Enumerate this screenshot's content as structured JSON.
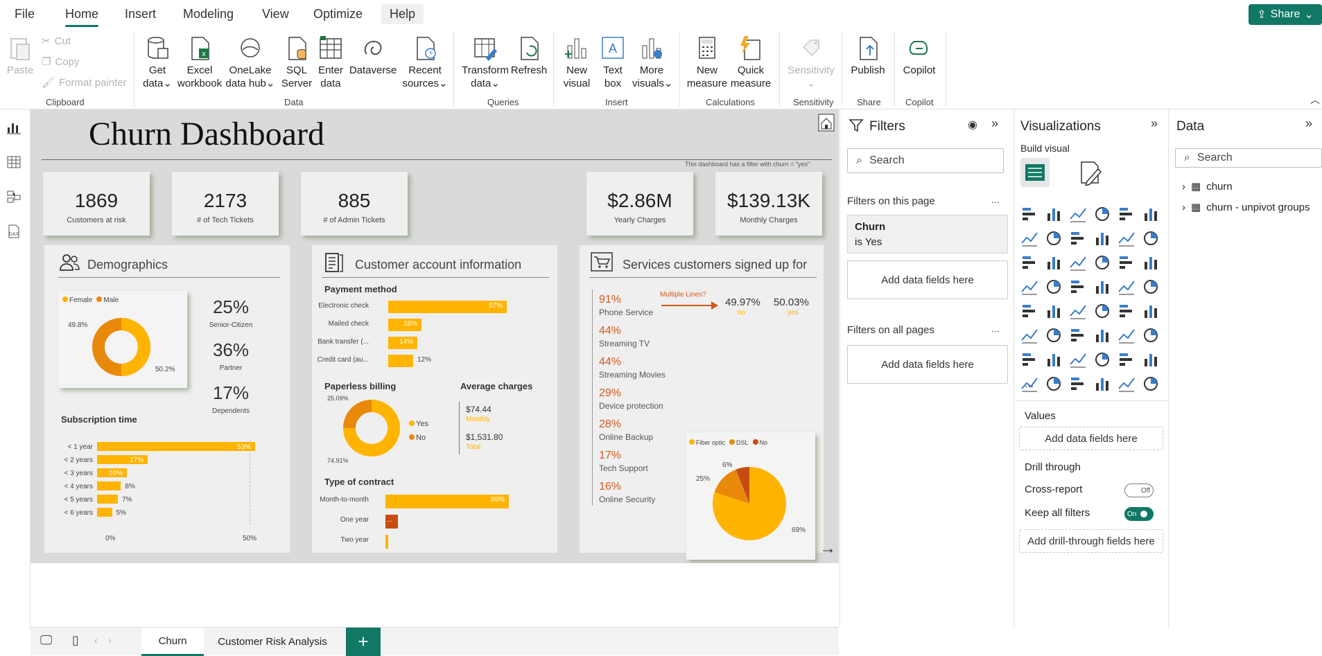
{
  "menu": {
    "file": "File",
    "home": "Home",
    "insert": "Insert",
    "modeling": "Modeling",
    "view": "View",
    "optimize": "Optimize",
    "help": "Help",
    "share": "Share"
  },
  "ribbon": {
    "clipboard": {
      "paste": "Paste",
      "cut": "Cut",
      "copy": "Copy",
      "format_painter": "Format painter",
      "label": "Clipboard"
    },
    "data": {
      "get_data": [
        "Get",
        "data"
      ],
      "excel": [
        "Excel",
        "workbook"
      ],
      "onelake": [
        "OneLake",
        "data hub"
      ],
      "sql": [
        "SQL",
        "Server"
      ],
      "enter": [
        "Enter",
        "data"
      ],
      "dataverse": "Dataverse",
      "recent": [
        "Recent",
        "sources"
      ],
      "label": "Data"
    },
    "queries": {
      "transform": [
        "Transform",
        "data"
      ],
      "refresh": "Refresh",
      "label": "Queries"
    },
    "insert": {
      "new_visual": [
        "New",
        "visual"
      ],
      "text_box": [
        "Text",
        "box"
      ],
      "more_visuals": [
        "More",
        "visuals"
      ],
      "label": "Insert"
    },
    "calculations": {
      "new_measure": [
        "New",
        "measure"
      ],
      "quick_measure": [
        "Quick",
        "measure"
      ],
      "label": "Calculations"
    },
    "sensitivity": {
      "sensitivity": "Sensitivity",
      "label": "Sensitivity"
    },
    "share": {
      "publish": "Publish",
      "label": "Share"
    },
    "copilot": {
      "copilot": "Copilot",
      "label": "Copilot"
    }
  },
  "dashboard": {
    "title": "Churn Dashboard",
    "filter_note": "This dashboard has a filter with churn = \"yes\"",
    "kpis": [
      {
        "value": "1869",
        "label": "Customers at risk"
      },
      {
        "value": "2173",
        "label": "# of Tech Tickets"
      },
      {
        "value": "885",
        "label": "# of Admin Tickets"
      },
      {
        "value": "$2.86M",
        "label": "Yearly Charges"
      },
      {
        "value": "$139.13K",
        "label": "Monthly Charges"
      }
    ],
    "demographics": {
      "title": "Demographics",
      "legend": [
        "Female",
        "Male"
      ],
      "donut_labels": [
        "49.8%",
        "50.2%"
      ],
      "stats": [
        {
          "value": "25%",
          "label": "Senior-Citizen"
        },
        {
          "value": "36%",
          "label": "Partner"
        },
        {
          "value": "17%",
          "label": "Dependents"
        }
      ],
      "subscription_title": "Subscription time",
      "subscription": [
        {
          "label": "< 1 year",
          "value": "53%",
          "pct": 53
        },
        {
          "label": "< 2 years",
          "value": "17%",
          "pct": 17
        },
        {
          "label": "< 3 years",
          "value": "10%",
          "pct": 10
        },
        {
          "label": "< 4 years",
          "value": "8%",
          "pct": 8
        },
        {
          "label": "< 5 years",
          "value": "7%",
          "pct": 7
        },
        {
          "label": "< 6 years",
          "value": "5%",
          "pct": 5
        }
      ],
      "axis": [
        "0%",
        "50%"
      ]
    },
    "account": {
      "title": "Customer account information",
      "payment_title": "Payment method",
      "payment": [
        {
          "label": "Electronic check",
          "value": "57%",
          "pct": 57
        },
        {
          "label": "Mailed check",
          "value": "16%",
          "pct": 16
        },
        {
          "label": "Bank transfer (...",
          "value": "14%",
          "pct": 14
        },
        {
          "label": "Credit card (au...",
          "value": "12%",
          "pct": 12
        }
      ],
      "paperless_title": "Paperless billing",
      "paperless_labels": [
        "25.09%",
        "74.91%"
      ],
      "paperless_legend": [
        "Yes",
        "No"
      ],
      "avg_title": "Average charges",
      "avg_monthly": "$74.44",
      "avg_monthly_lbl": "Monthly",
      "avg_total": "$1,531.80",
      "avg_total_lbl": "Total",
      "contract_title": "Type of contract",
      "contract": [
        {
          "label": "Month-to-month",
          "value": "89%",
          "pct": 89
        },
        {
          "label": "One year",
          "value": "...",
          "pct": 9
        },
        {
          "label": "Two year",
          "value": "",
          "pct": 2
        }
      ]
    },
    "services": {
      "title": "Services customers signed up for",
      "items": [
        {
          "pct": "91%",
          "name": "Phone Service"
        },
        {
          "pct": "44%",
          "name": "Streaming TV"
        },
        {
          "pct": "44%",
          "name": "Streaming Movies"
        },
        {
          "pct": "29%",
          "name": "Device protection"
        },
        {
          "pct": "28%",
          "name": "Online Backup"
        },
        {
          "pct": "17%",
          "name": "Tech Support"
        },
        {
          "pct": "16%",
          "name": "Online Security"
        }
      ],
      "multiple_lines": "Multiple Lines?",
      "ml_no": "49.97%",
      "ml_no_lbl": "no",
      "ml_yes": "50.03%",
      "ml_yes_lbl": "yes",
      "internet_legend": [
        "Fiber optic",
        "DSL",
        "No"
      ],
      "pie_labels": [
        "69%",
        "25%",
        "6%"
      ]
    }
  },
  "filters": {
    "title": "Filters",
    "search": "Search",
    "on_page": "Filters on this page",
    "card_title": "Churn",
    "card_value": "is Yes",
    "add_fields": "Add data fields here",
    "all_pages": "Filters on all pages",
    "more": "..."
  },
  "viz": {
    "title": "Visualizations",
    "build": "Build visual",
    "values": "Values",
    "add_fields": "Add data fields here",
    "drill": "Drill through",
    "cross_report": "Cross-report",
    "cross_state": "Off",
    "keep_filters": "Keep all filters",
    "keep_state": "On",
    "add_drill": "Add drill-through fields here",
    "more": "..."
  },
  "data_pane": {
    "title": "Data",
    "search": "Search",
    "tables": [
      "churn",
      "churn - unpivot groups"
    ]
  },
  "pages": {
    "tab1": "Churn",
    "tab2": "Customer Risk Analysis",
    "add": "+"
  },
  "colors": {
    "accent": "#117865",
    "bar": "#ffb400",
    "donut_dark": "#e8890c",
    "orange": "#d4581a"
  },
  "chart_data": [
    {
      "type": "pie",
      "title": "",
      "categories": [
        "Female",
        "Male"
      ],
      "values": [
        49.8,
        50.2
      ]
    },
    {
      "type": "bar",
      "title": "Subscription time",
      "categories": [
        "< 1 year",
        "< 2 years",
        "< 3 years",
        "< 4 years",
        "< 5 years",
        "< 6 years"
      ],
      "values": [
        53,
        17,
        10,
        8,
        7,
        5
      ]
    },
    {
      "type": "bar",
      "title": "Payment method",
      "categories": [
        "Electronic check",
        "Mailed check",
        "Bank transfer (...",
        "Credit card (au..."
      ],
      "values": [
        57,
        16,
        14,
        12
      ]
    },
    {
      "type": "pie",
      "title": "Paperless billing",
      "categories": [
        "Yes",
        "No"
      ],
      "values": [
        74.91,
        25.09
      ]
    },
    {
      "type": "bar",
      "title": "Type of contract",
      "categories": [
        "Month-to-month",
        "One year",
        "Two year"
      ],
      "values": [
        89,
        9,
        2
      ]
    },
    {
      "type": "pie",
      "title": "",
      "categories": [
        "Fiber optic",
        "DSL",
        "No"
      ],
      "values": [
        69,
        25,
        6
      ]
    }
  ]
}
